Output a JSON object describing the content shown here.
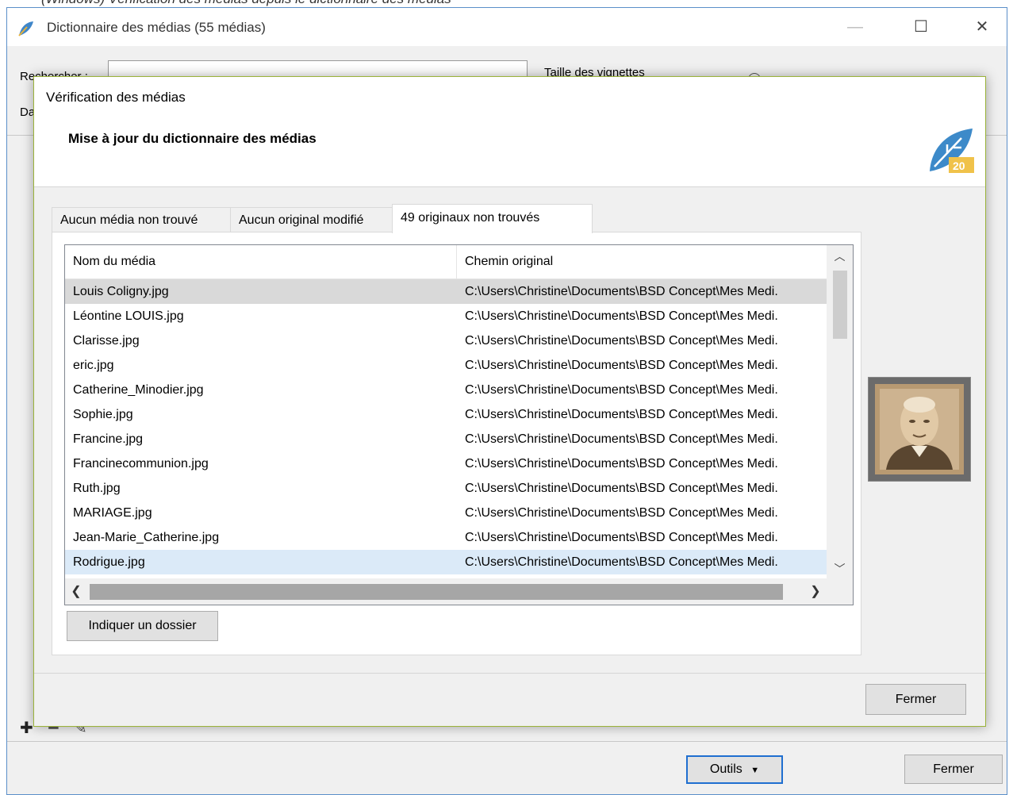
{
  "caption": "(Windows) Vérification des médias depuis le dictionnaire des médias",
  "main_window": {
    "title": "Dictionnaire des médias (55 médias)",
    "search_label": "Rechercher :",
    "thumb_size_label": "Taille des vignettes",
    "da_label": "Da",
    "tools_label": "Outils",
    "close_label": "Fermer"
  },
  "dialog": {
    "title": "Vérification des médias",
    "subtitle": "Mise à jour du dictionnaire des médias",
    "logo_badge": "20",
    "tabs": [
      {
        "label": "Aucun média non trouvé"
      },
      {
        "label": "Aucun original modifié"
      },
      {
        "label": "49 originaux non trouvés"
      }
    ],
    "table": {
      "columns": [
        "Nom du média",
        "Chemin original"
      ],
      "rows": [
        {
          "name": "Louis Coligny.jpg",
          "path": "C:\\Users\\Christine\\Documents\\BSD Concept\\Mes Medi."
        },
        {
          "name": "Léontine LOUIS.jpg",
          "path": "C:\\Users\\Christine\\Documents\\BSD Concept\\Mes Medi."
        },
        {
          "name": "Clarisse.jpg",
          "path": "C:\\Users\\Christine\\Documents\\BSD Concept\\Mes Medi."
        },
        {
          "name": "eric.jpg",
          "path": "C:\\Users\\Christine\\Documents\\BSD Concept\\Mes Medi."
        },
        {
          "name": "Catherine_Minodier.jpg",
          "path": "C:\\Users\\Christine\\Documents\\BSD Concept\\Mes Medi."
        },
        {
          "name": "Sophie.jpg",
          "path": "C:\\Users\\Christine\\Documents\\BSD Concept\\Mes Medi."
        },
        {
          "name": "Francine.jpg",
          "path": "C:\\Users\\Christine\\Documents\\BSD Concept\\Mes Medi."
        },
        {
          "name": "Francinecommunion.jpg",
          "path": "C:\\Users\\Christine\\Documents\\BSD Concept\\Mes Medi."
        },
        {
          "name": "Ruth.jpg",
          "path": "C:\\Users\\Christine\\Documents\\BSD Concept\\Mes Medi."
        },
        {
          "name": "MARIAGE.jpg",
          "path": "C:\\Users\\Christine\\Documents\\BSD Concept\\Mes Medi."
        },
        {
          "name": "Jean-Marie_Catherine.jpg",
          "path": "C:\\Users\\Christine\\Documents\\BSD Concept\\Mes Medi."
        },
        {
          "name": "Rodrigue.jpg",
          "path": "C:\\Users\\Christine\\Documents\\BSD Concept\\Mes Medi."
        }
      ]
    },
    "folder_button_label": "Indiquer un dossier",
    "close_label": "Fermer"
  },
  "colors": {
    "accent": "#1f6fd0",
    "dialog_border": "#9bb33a",
    "row_selected": "#d9d9d9",
    "row_hover": "#dbeaf8"
  },
  "icons": [
    "app-logo-icon",
    "minimize-icon",
    "maximize-icon",
    "close-icon",
    "add-icon",
    "remove-icon",
    "edit-icon",
    "scroll-up-icon",
    "scroll-down-icon",
    "scroll-left-icon",
    "scroll-right-icon",
    "dropdown-arrow-icon"
  ]
}
